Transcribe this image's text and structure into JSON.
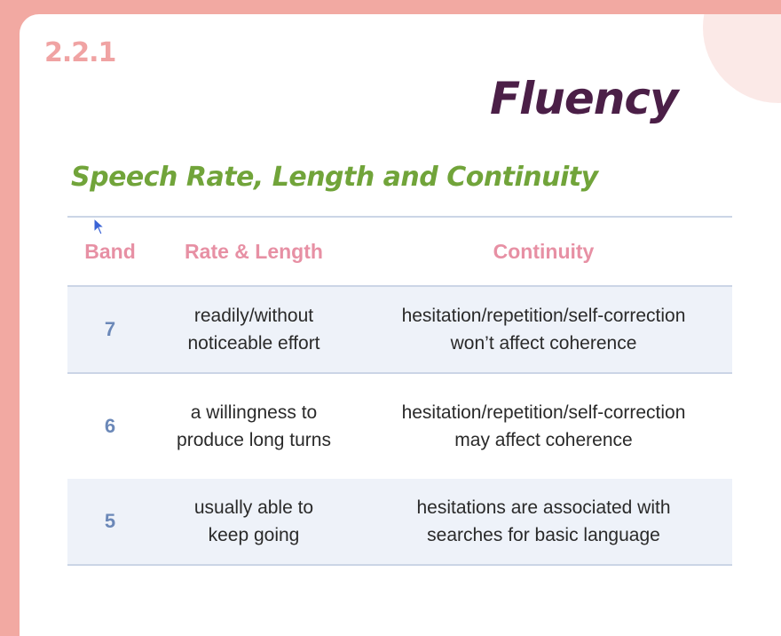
{
  "slide": {
    "section_number": "2.2.1",
    "title": "Fluency",
    "subtitle": "Speech Rate, Length and Continuity"
  },
  "table": {
    "headers": {
      "band": "Band",
      "rate": "Rate & Length",
      "continuity": "Continuity"
    },
    "rows": [
      {
        "band": "7",
        "rate": [
          "readily/without",
          "noticeable effort"
        ],
        "continuity": [
          "hesitation/repetition/self-correction",
          "won’t affect coherence"
        ]
      },
      {
        "band": "6",
        "rate": [
          "a willingness to",
          "produce long turns"
        ],
        "continuity": [
          "hesitation/repetition/self-correction",
          "may affect coherence"
        ]
      },
      {
        "band": "5",
        "rate": [
          "usually able to",
          "keep going"
        ],
        "continuity": [
          "hesitations are associated with",
          "searches for basic language"
        ]
      }
    ]
  },
  "colors": {
    "background": "#f2a9a2",
    "title": "#4b1f47",
    "subtitle": "#71a43a",
    "header_text": "#e790a4",
    "band_number": "#6b88b8",
    "row_shade": "#eef2f9"
  }
}
